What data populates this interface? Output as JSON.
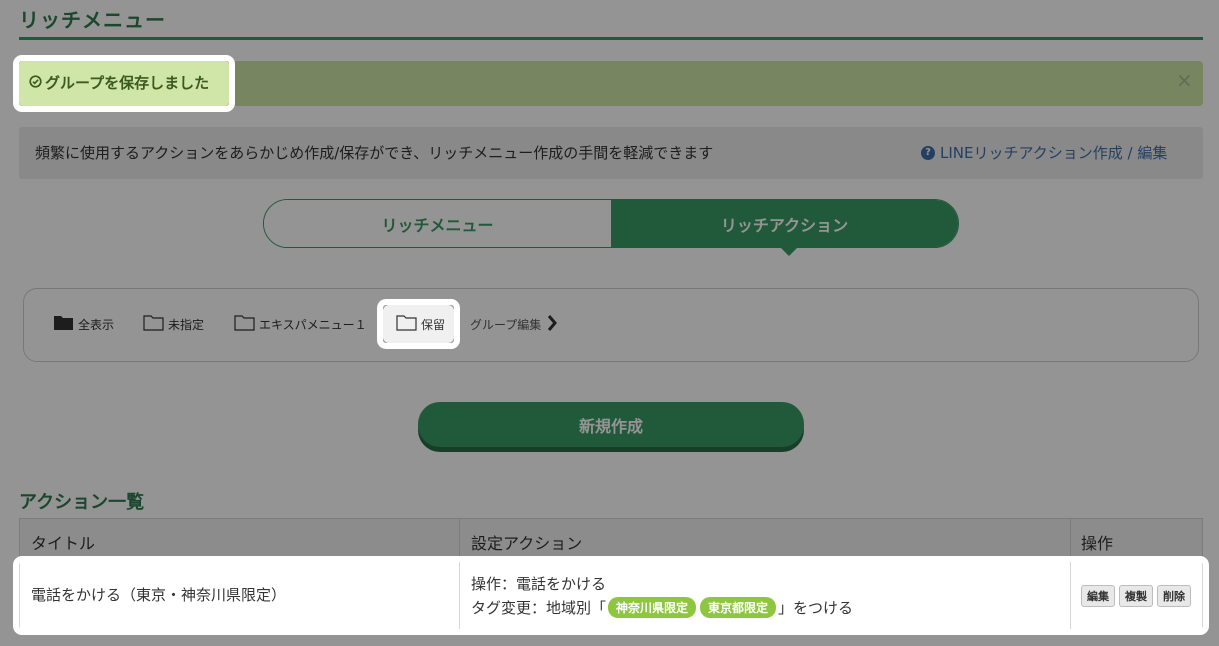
{
  "page": {
    "title": "リッチメニュー"
  },
  "alert": {
    "icon": "check-circle-icon",
    "message": "グループを保存しました",
    "close": "×"
  },
  "info": {
    "text": "頻繁に使用するアクションをあらかじめ作成/保存ができ、リッチメニュー作成の手間を軽減できます",
    "link_icon": "help-circle-icon",
    "link_text": "LINEリッチアクション作成 / 編集"
  },
  "tabs": {
    "left": "リッチメニュー",
    "right": "リッチアクション",
    "active": "リッチアクション"
  },
  "folders": {
    "items": [
      {
        "label": "全表示",
        "icon": "folder-filled-icon"
      },
      {
        "label": "未指定",
        "icon": "folder-icon"
      },
      {
        "label": "エキスパメニュー１",
        "icon": "folder-icon"
      },
      {
        "label": "保留",
        "icon": "folder-icon"
      }
    ],
    "selected": "保留",
    "group_edit": "グループ編集",
    "group_edit_icon": "chevron-right-icon"
  },
  "new_button": "新規作成",
  "section": {
    "title": "アクション一覧"
  },
  "table": {
    "headers": [
      "タイトル",
      "設定アクション",
      "操作"
    ],
    "rows": [
      {
        "title": "電話をかける（東京・神奈川県限定）",
        "action_line1": "操作：電話をかける",
        "action_line2_prefix": "タグ変更：地域別「",
        "tags": [
          "神奈川県限定",
          "東京都限定"
        ],
        "action_line2_suffix": "」をつける",
        "buttons": [
          "編集",
          "複製",
          "削除"
        ]
      }
    ]
  },
  "colors": {
    "brand_green": "#3a9a66",
    "alert_bg": "#cfe6a8",
    "tag_green": "#8ec63f",
    "link_blue": "#3d6fa7"
  }
}
